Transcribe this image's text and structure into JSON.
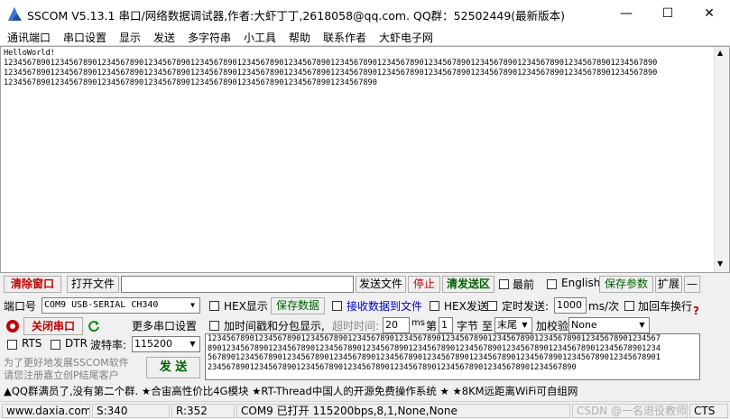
{
  "title": "SSCOM V5.13.1 串口/网络数据调试器,作者:大虾丁丁,2618058@qq.com. QQ群：52502449(最新版本)",
  "window_controls": {
    "minimize": "—",
    "maximize": "☐",
    "close": "✕"
  },
  "menu": [
    "通讯端口",
    "串口设置",
    "显示",
    "发送",
    "多字符串",
    "小工具",
    "帮助",
    "联系作者",
    "大虾电子网"
  ],
  "receive": {
    "lines": [
      "HelloWorld!",
      "12345678901234567890123456789012345678901234567890123456789012345678901234567890123456789012345678901234567890123456789012345678901234567890",
      "12345678901234567890123456789012345678901234567890123456789012345678901234567890123456789012345678901234567890123456789012345678901234567890",
      "12345678901234567890123456789012345678901234567890123456789012345678901234567890"
    ]
  },
  "row1": {
    "clear_window": "清除窗口",
    "open_file": "打开文件",
    "file_path": "",
    "send_file": "发送文件",
    "stop": "停止",
    "clear_send": "清发送区",
    "topmost": "最前",
    "english": "English",
    "save_params": "保存参数",
    "expand": "扩展",
    "collapse": "—"
  },
  "row2": {
    "port_label": "端口号",
    "port_value": "COM9 USB-SERIAL CH340",
    "hex_display": "HEX显示",
    "save_data": "保存数据",
    "recv_to_file": "接收数据到文件",
    "hex_send": "HEX发送",
    "timed_send": "定时发送:",
    "interval": "1000",
    "interval_unit": "ms/次",
    "add_crlf": "加回车换行"
  },
  "row3": {
    "close_port": "关闭串口",
    "more_settings": "更多串口设置",
    "timestamp": "加时间戳和分包显示,",
    "timeout_label": "超时时间:",
    "timeout": "20",
    "timeout_unit": "ms",
    "nth_label": "第",
    "nth": "1",
    "byte_label": "字节",
    "to_label": "至",
    "end_value": "末尾",
    "checksum_label": "加校验",
    "checksum_value": "None"
  },
  "row4": {
    "rts": "RTS",
    "dtr": "DTR",
    "baud_label": "波特率:",
    "baud": "115200"
  },
  "promo": [
    "为了更好地发展SSCOM软件",
    "请您注册嘉立创P结尾客户"
  ],
  "send_button": "发 送",
  "send_text": [
    "1234567890123456789012345678901234567890123456789012345678901234567890123456789012345678901234567",
    "8901234567890123456789012345678901234567890123456789012345678901234567890123456789012345678901234",
    "5678901234567890123456789012345678901234567890123456789012345678901234567890123456789012345678901",
    "2345678901234567890123456789012345678901234567890123456789012345678901234567890"
  ],
  "ticker": "▲QQ群满员了,没有第二个群. ★合宙高性价比4G模块 ★RT-Thread中国人的开源免费操作系统 ★ ★8KM远距离WiFi可自组网",
  "status": {
    "site": "www.daxia.com",
    "sent": "S:340",
    "recv": "R:352",
    "port_status": "COM9 已打开  115200bps,8,1,None,None",
    "cts": "CTS"
  },
  "watermark": "CSDN @一名退役教师",
  "colors": {
    "accent_red": "#c00000",
    "accent_green": "#006000",
    "accent_blue": "#0000c0"
  }
}
